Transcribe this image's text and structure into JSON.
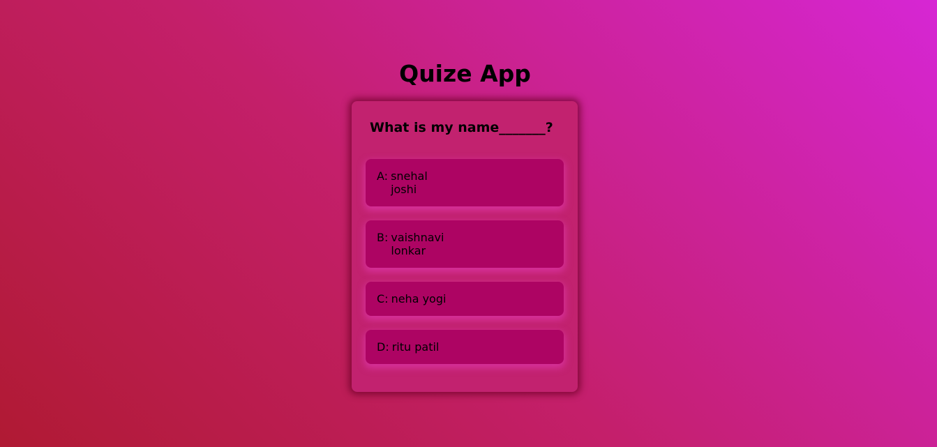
{
  "app": {
    "title": "Quize App"
  },
  "quiz": {
    "question": "What is my name_______?",
    "options": [
      {
        "letter": "A:",
        "text": "snehal joshi"
      },
      {
        "letter": "B:",
        "text": "vaishnavi lonkar"
      },
      {
        "letter": "C:",
        "text": "neha yogi"
      },
      {
        "letter": "D:",
        "text": "ritu patil"
      }
    ]
  },
  "colors": {
    "background_start": "#b01a33",
    "background_end": "#d626d4",
    "card": "#c2226f",
    "option": "#ad0463"
  }
}
